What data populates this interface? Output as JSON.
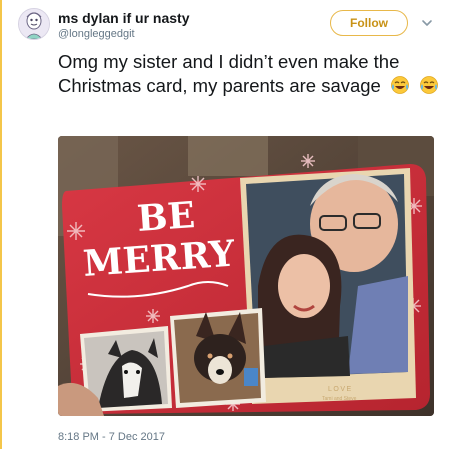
{
  "tweet": {
    "display_name": "ms dylan if ur nasty",
    "handle": "@longleggedgit",
    "follow_label": "Follow",
    "text": "Omg my sister and I didn’t even make the Christmas card, my parents are savage",
    "timestamp": "8:18 PM - 7 Dec 2017"
  },
  "card": {
    "headline_1": "BE",
    "headline_2": "MERRY",
    "love_label": "LOVE",
    "signature": "Tami and Steve"
  },
  "icons": {
    "emoji_1": "face-with-tears-of-joy-icon",
    "emoji_2": "face-with-tears-of-joy-icon",
    "caret": "chevron-down-icon"
  },
  "colors": {
    "follow_accent": "#e8b84a",
    "card_red": "#cf2f3a",
    "text_secondary": "#657786"
  }
}
